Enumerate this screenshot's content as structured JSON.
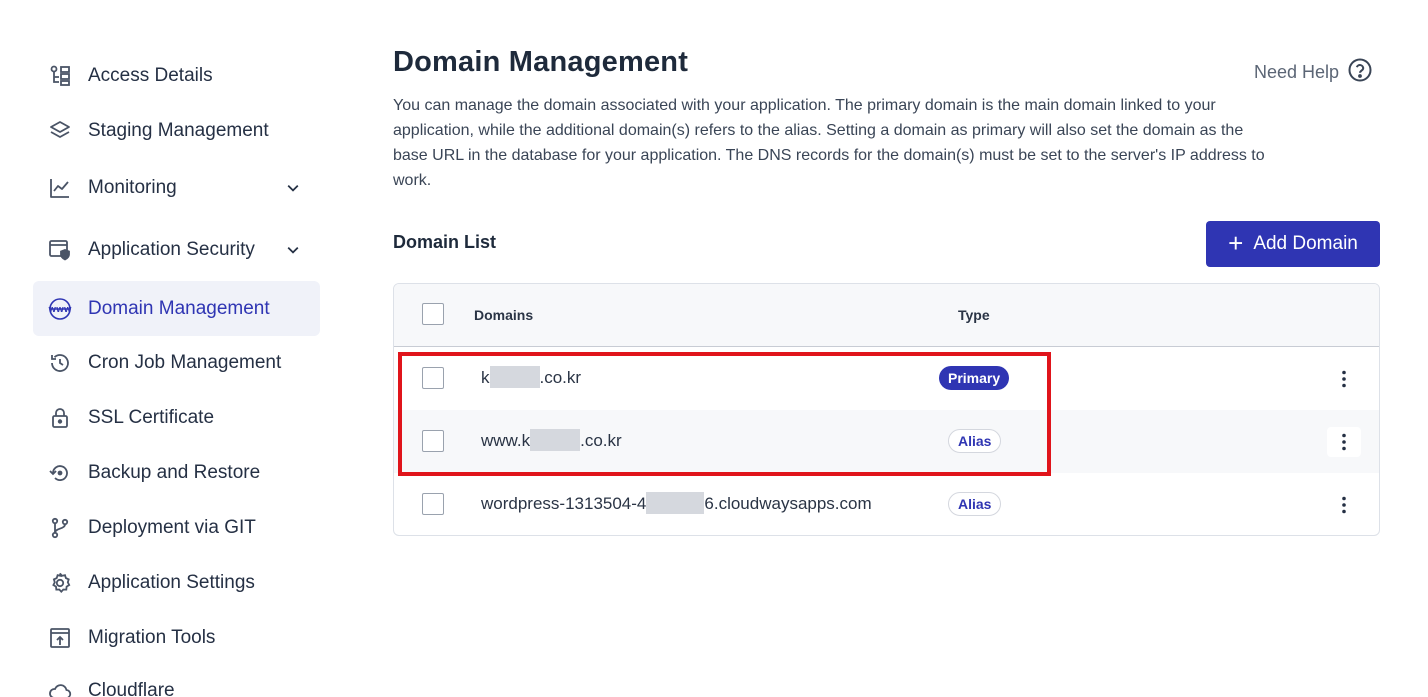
{
  "sidebar": {
    "items": [
      {
        "label": "Access Details",
        "icon": "access-details-icon"
      },
      {
        "label": "Staging Management",
        "icon": "layers-icon"
      },
      {
        "label": "Monitoring",
        "icon": "chart-line-icon",
        "expandable": true
      },
      {
        "label": "Application Security",
        "icon": "shield-window-icon",
        "expandable": true
      },
      {
        "label": "Domain Management",
        "icon": "www-icon",
        "active": true
      },
      {
        "label": "Cron Job Management",
        "icon": "history-icon"
      },
      {
        "label": "SSL Certificate",
        "icon": "lock-icon"
      },
      {
        "label": "Backup and Restore",
        "icon": "restore-icon"
      },
      {
        "label": "Deployment via GIT",
        "icon": "git-branch-icon"
      },
      {
        "label": "Application Settings",
        "icon": "gear-icon"
      },
      {
        "label": "Migration Tools",
        "icon": "migration-icon"
      },
      {
        "label": "Cloudflare",
        "icon": "cloud-icon"
      }
    ]
  },
  "header": {
    "title": "Domain Management",
    "help_label": "Need Help",
    "description": "You can manage the domain associated with your application. The primary domain is the main domain linked to your application, while the additional domain(s) refers to the alias. Setting a domain as primary will also set the domain as the base URL in the database for your application. The DNS records for the domain(s) must be set to the server's IP address to work."
  },
  "domain_list": {
    "title": "Domain List",
    "add_button": "Add Domain",
    "columns": {
      "domains": "Domains",
      "type": "Type"
    },
    "rows": [
      {
        "domain_prefix": "k",
        "domain_suffix": ".co.kr",
        "type": "Primary"
      },
      {
        "domain_prefix": "www.k",
        "domain_suffix": ".co.kr",
        "type": "Alias"
      },
      {
        "domain_prefix": "wordpress-1313504-4",
        "domain_suffix": "6.cloudwaysapps.com",
        "type": "Alias"
      }
    ]
  },
  "colors": {
    "accent": "#2f35b3",
    "highlight_border": "#e0141b",
    "text": "#1e2a3b"
  }
}
